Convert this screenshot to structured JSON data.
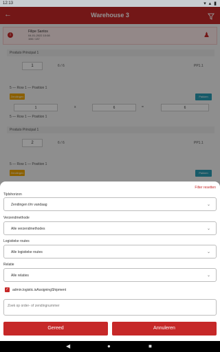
{
  "status_bar": {
    "time": "12:13",
    "icons": "▾ ▴ ▮"
  },
  "app_bar": {
    "title": "Warehouse 3",
    "back_icon": "arrow-left-icon",
    "filter_icon": "funnel-icon"
  },
  "user_bar": {
    "name": "Filipe Santos",
    "line2": "04-01-2022 10:08",
    "line3": "198 / 137"
  },
  "background_list": {
    "section1": {
      "header": "Produto Principal 1",
      "qty": "1",
      "fraction": "6 / 6",
      "code": "PP1.1",
      "location": "5 — Row 1 — Position 1",
      "orange_btn": "Zendingen",
      "teal_btn": "Pakken",
      "factor_a": "1",
      "times": "x",
      "factor_b": "6",
      "equals": "=",
      "result": "6",
      "sub": "5 — Row 1 — Position 1"
    },
    "section2": {
      "header": "Produto Principal 1",
      "qty": "2",
      "fraction": "6 / 6",
      "code": "PP1.1",
      "location": "5 — Row 1 — Position 1",
      "orange_btn": "Zendingen",
      "teal_btn": "Pakken"
    }
  },
  "filter_sheet": {
    "reset_label": "Filter resetten",
    "time_horizon": {
      "label": "Tijdshorizon",
      "value": "Zendingen t/m vandaag"
    },
    "shipping_method": {
      "label": "Verzendmethode",
      "value": "Alle verzendmethodes"
    },
    "logistic_routes": {
      "label": "Logistieke routes",
      "value": "Alle logistieke routes"
    },
    "relation": {
      "label": "Relatie",
      "value": "Alle relaties"
    },
    "checkbox": {
      "label": "admin.logistic.isAssigningShipment",
      "checked": true
    },
    "search": {
      "placeholder": "Zoek op order- of zendingnummer",
      "value": ""
    },
    "done_button": "Gereed",
    "cancel_button": "Annuleren"
  },
  "colors": {
    "primary": "#c62828",
    "orange": "#f0a500",
    "teal": "#2a9db5"
  }
}
